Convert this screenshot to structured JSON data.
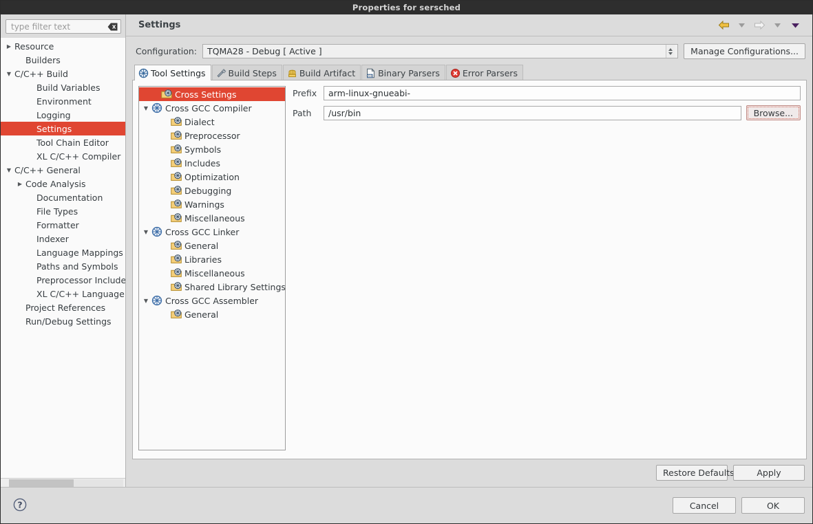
{
  "window": {
    "title": "Properties for sersched"
  },
  "sidebar": {
    "filter": {
      "placeholder": "type filter text",
      "value": "",
      "clear_icon": "clear-backspace-icon"
    },
    "items": [
      {
        "label": "Resource",
        "indent": 0,
        "twisty": "closed"
      },
      {
        "label": "Builders",
        "indent": 1,
        "twisty": "none"
      },
      {
        "label": "C/C++ Build",
        "indent": 0,
        "twisty": "open"
      },
      {
        "label": "Build Variables",
        "indent": 2,
        "twisty": "none"
      },
      {
        "label": "Environment",
        "indent": 2,
        "twisty": "none"
      },
      {
        "label": "Logging",
        "indent": 2,
        "twisty": "none"
      },
      {
        "label": "Settings",
        "indent": 2,
        "twisty": "none",
        "selected": true
      },
      {
        "label": "Tool Chain Editor",
        "indent": 2,
        "twisty": "none"
      },
      {
        "label": "XL C/C++ Compiler",
        "indent": 2,
        "twisty": "none"
      },
      {
        "label": "C/C++ General",
        "indent": 0,
        "twisty": "open"
      },
      {
        "label": "Code Analysis",
        "indent": 1,
        "twisty": "closed"
      },
      {
        "label": "Documentation",
        "indent": 2,
        "twisty": "none"
      },
      {
        "label": "File Types",
        "indent": 2,
        "twisty": "none"
      },
      {
        "label": "Formatter",
        "indent": 2,
        "twisty": "none"
      },
      {
        "label": "Indexer",
        "indent": 2,
        "twisty": "none"
      },
      {
        "label": "Language Mappings",
        "indent": 2,
        "twisty": "none"
      },
      {
        "label": "Paths and Symbols",
        "indent": 2,
        "twisty": "none"
      },
      {
        "label": "Preprocessor Include",
        "indent": 2,
        "twisty": "none"
      },
      {
        "label": "XL C/C++ Language (",
        "indent": 2,
        "twisty": "none"
      },
      {
        "label": "Project References",
        "indent": 1,
        "twisty": "none"
      },
      {
        "label": "Run/Debug Settings",
        "indent": 1,
        "twisty": "none"
      }
    ],
    "selected_color": "#e04632",
    "help_icon": "help-question-icon"
  },
  "header": {
    "title": "Settings",
    "nav": [
      {
        "name": "back-arrow-icon",
        "kind": "arrow-left-filled"
      },
      {
        "name": "back-history-dropdown-icon",
        "kind": "triangle-gray"
      },
      {
        "name": "forward-arrow-icon",
        "kind": "arrow-right-outline"
      },
      {
        "name": "forward-history-dropdown-icon",
        "kind": "triangle-gray"
      },
      {
        "name": "view-menu-icon",
        "kind": "triangle-dark"
      }
    ]
  },
  "configuration": {
    "label": "Configuration:",
    "value": "TQMA28 - Debug  [ Active ]",
    "manage_button": "Manage Configurations..."
  },
  "tabs": [
    {
      "label": "Tool Settings",
      "icon": "tool-settings-icon",
      "active": true
    },
    {
      "label": "Build Steps",
      "icon": "build-steps-icon",
      "active": false
    },
    {
      "label": "Build Artifact",
      "icon": "build-artifact-icon",
      "active": false
    },
    {
      "label": "Binary Parsers",
      "icon": "binary-parsers-icon",
      "active": false
    },
    {
      "label": "Error Parsers",
      "icon": "error-parsers-icon",
      "active": false
    }
  ],
  "tool_tree": [
    {
      "label": "Cross Settings",
      "indent": 1,
      "twisty": "none",
      "icon": "folder-tool-icon",
      "selected": true
    },
    {
      "label": "Cross GCC Compiler",
      "indent": 0,
      "twisty": "open",
      "icon": "toolchain-wheel-icon"
    },
    {
      "label": "Dialect",
      "indent": 2,
      "twisty": "none",
      "icon": "folder-tool-icon"
    },
    {
      "label": "Preprocessor",
      "indent": 2,
      "twisty": "none",
      "icon": "folder-tool-icon"
    },
    {
      "label": "Symbols",
      "indent": 2,
      "twisty": "none",
      "icon": "folder-tool-icon"
    },
    {
      "label": "Includes",
      "indent": 2,
      "twisty": "none",
      "icon": "folder-tool-icon"
    },
    {
      "label": "Optimization",
      "indent": 2,
      "twisty": "none",
      "icon": "folder-tool-icon"
    },
    {
      "label": "Debugging",
      "indent": 2,
      "twisty": "none",
      "icon": "folder-tool-icon"
    },
    {
      "label": "Warnings",
      "indent": 2,
      "twisty": "none",
      "icon": "folder-tool-icon"
    },
    {
      "label": "Miscellaneous",
      "indent": 2,
      "twisty": "none",
      "icon": "folder-tool-icon"
    },
    {
      "label": "Cross GCC Linker",
      "indent": 0,
      "twisty": "open",
      "icon": "toolchain-wheel-icon"
    },
    {
      "label": "General",
      "indent": 2,
      "twisty": "none",
      "icon": "folder-tool-icon"
    },
    {
      "label": "Libraries",
      "indent": 2,
      "twisty": "none",
      "icon": "folder-tool-icon"
    },
    {
      "label": "Miscellaneous",
      "indent": 2,
      "twisty": "none",
      "icon": "folder-tool-icon"
    },
    {
      "label": "Shared Library Settings",
      "indent": 2,
      "twisty": "none",
      "icon": "folder-tool-icon"
    },
    {
      "label": "Cross GCC Assembler",
      "indent": 0,
      "twisty": "open",
      "icon": "toolchain-wheel-icon"
    },
    {
      "label": "General",
      "indent": 2,
      "twisty": "none",
      "icon": "folder-tool-icon"
    }
  ],
  "form": {
    "prefix": {
      "label": "Prefix",
      "value": "arm-linux-gnueabi-"
    },
    "path": {
      "label": "Path",
      "value": "/usr/bin",
      "browse_label": "Browse..."
    }
  },
  "footer": {
    "restore_defaults": "Restore Defaults",
    "apply": "Apply",
    "cancel": "Cancel",
    "ok": "OK"
  }
}
